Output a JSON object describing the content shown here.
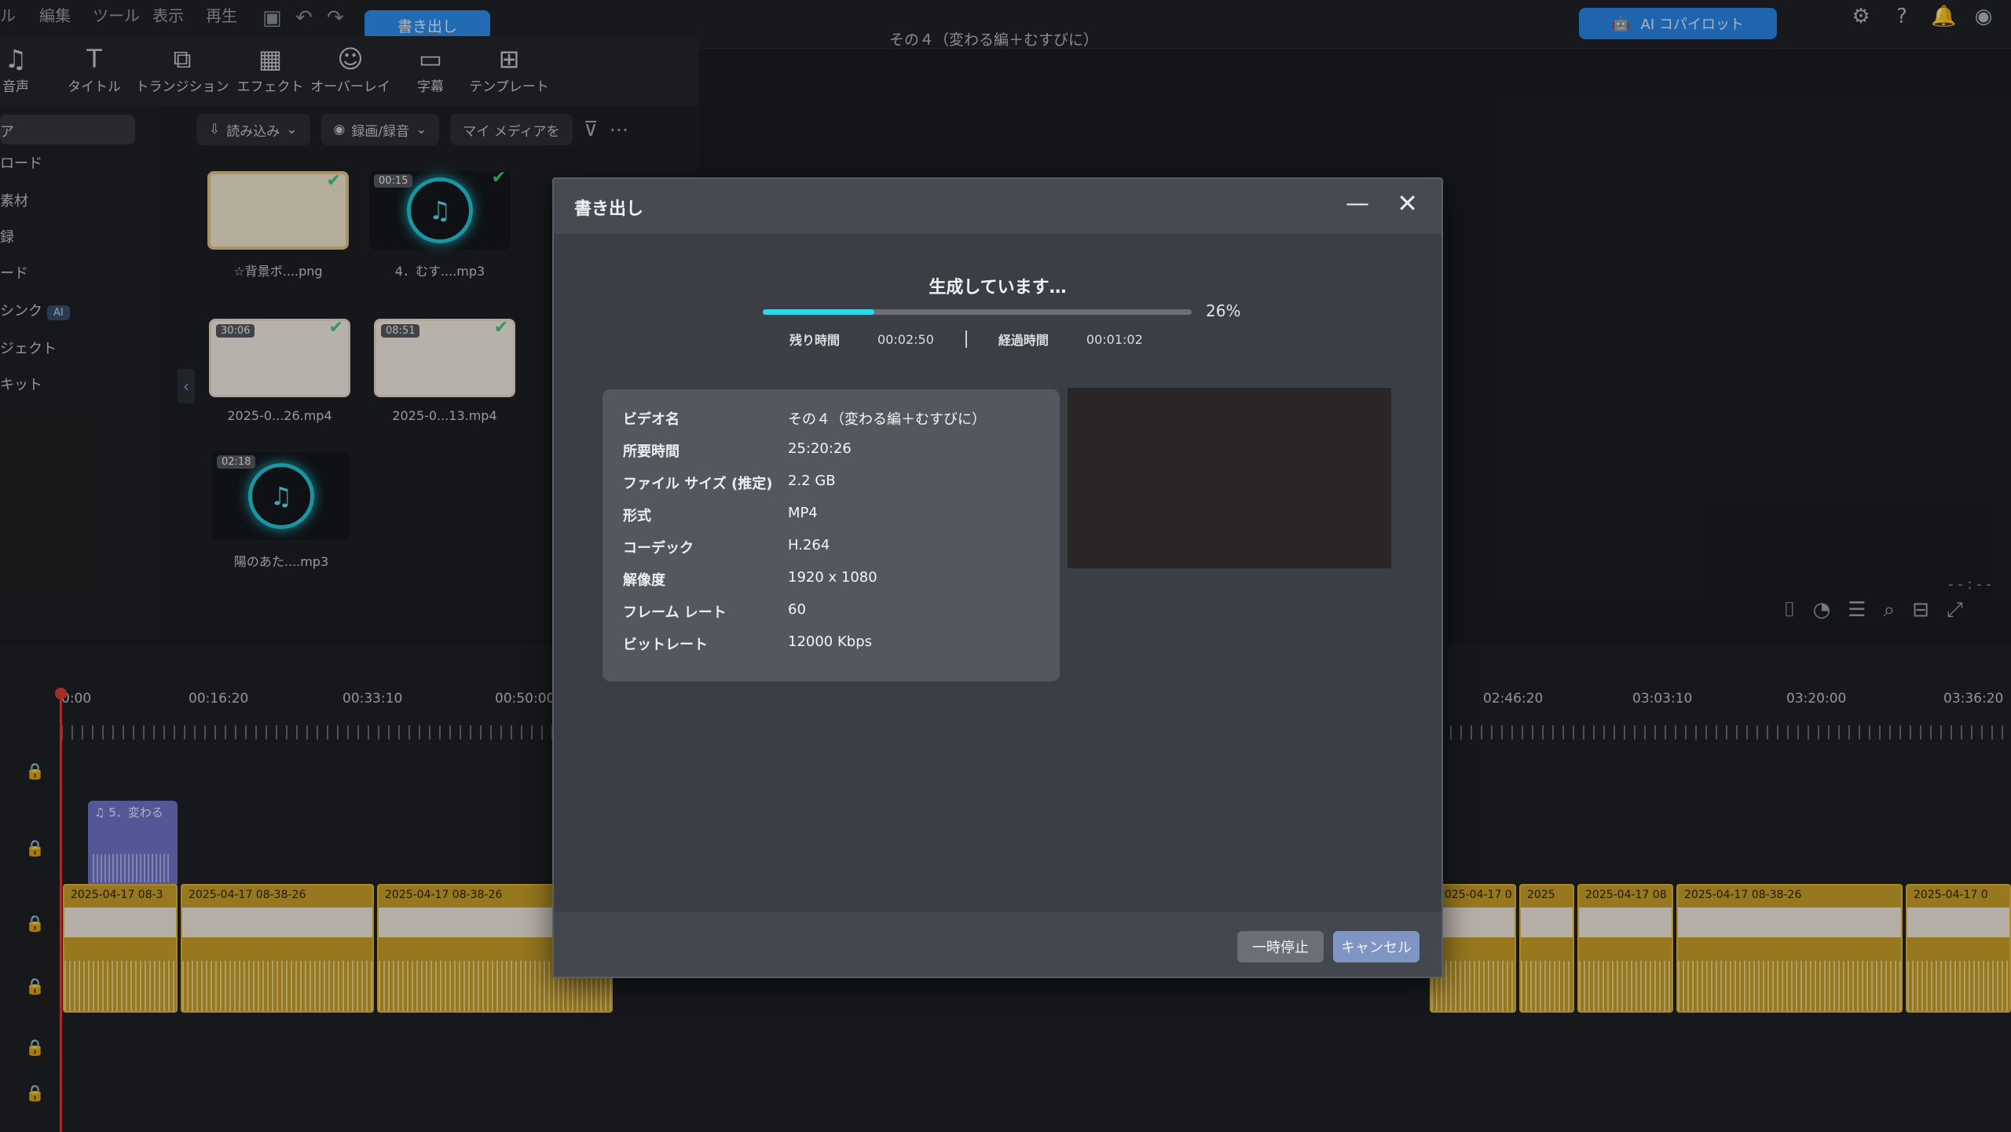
{
  "menu": {
    "items": [
      "ル",
      "編集",
      "ツール",
      "表示",
      "再生"
    ],
    "export_button": "書き出し"
  },
  "window_title": "その４（変わる編＋むすびに）",
  "ai_copilot": "AI コパイロット",
  "media_toolbar": [
    {
      "icon": "music-note-icon",
      "label": "音声"
    },
    {
      "icon": "title-t-icon",
      "label": "タイトル"
    },
    {
      "icon": "transition-icon",
      "label": "トランジション"
    },
    {
      "icon": "effect-icon",
      "label": "エフェクト"
    },
    {
      "icon": "overlay-icon",
      "label": "オーバーレイ"
    },
    {
      "icon": "subtitle-icon",
      "label": "字幕"
    },
    {
      "icon": "template-icon",
      "label": "テンプレート"
    }
  ],
  "sidebar": {
    "items": [
      "ア",
      "ロード",
      "素材",
      "録",
      "ード",
      "シンク",
      "ジェクト",
      "キット"
    ],
    "ai_badge": "AI"
  },
  "filters": {
    "import": "読み込み",
    "record": "録画/録音",
    "my_media": "マイ メディアを"
  },
  "media": [
    {
      "name": "☆背景ボ....png",
      "type": "image",
      "duration": ""
    },
    {
      "name": "4．むす....mp3",
      "type": "audio",
      "duration": "00:15"
    },
    {
      "name": "2025-0...26.mp4",
      "type": "video",
      "duration": "30:06"
    },
    {
      "name": "2025-0...13.mp4",
      "type": "video",
      "duration": "08:51"
    },
    {
      "name": "陽のあた....mp3",
      "type": "audio",
      "duration": "02:18"
    }
  ],
  "timeline": {
    "ruler_labels": [
      "0:00",
      "00:16:20",
      "00:33:10",
      "00:50:00",
      "02:46:20",
      "03:03:10",
      "03:20:00",
      "03:36:20"
    ],
    "audio_clip_label": "5．変わる",
    "video_clips": [
      "2025-04-17 08-3",
      "2025-04-17 08-38-26",
      "2025-04-17 08-38-26",
      "2025-04-17 0",
      "2025",
      "2025-04-17 08",
      "2025-04-17 08-38-26",
      "2025-04-17 0"
    ]
  },
  "preview": {
    "time_readout": "- - : - -"
  },
  "export_dialog": {
    "title": "書き出し",
    "status": "生成しています…",
    "progress_percent": 26,
    "progress_label": "26%",
    "remaining_label": "残り時間",
    "remaining_value": "00:02:50",
    "elapsed_label": "経過時間",
    "elapsed_value": "00:01:02",
    "info": [
      {
        "key": "ビデオ名",
        "value": "その４（変わる編＋むすびに）"
      },
      {
        "key": "所要時間",
        "value": "25:20:26"
      },
      {
        "key": "ファイル サイズ (推定)",
        "value": "2.2 GB"
      },
      {
        "key": "形式",
        "value": "MP4"
      },
      {
        "key": "コーデック",
        "value": "H.264"
      },
      {
        "key": "解像度",
        "value": "1920 x 1080"
      },
      {
        "key": "フレーム レート",
        "value": "60"
      },
      {
        "key": "ビットレート",
        "value": "12000 Kbps"
      }
    ],
    "pause_button": "一時停止",
    "cancel_button": "キャンセル"
  }
}
